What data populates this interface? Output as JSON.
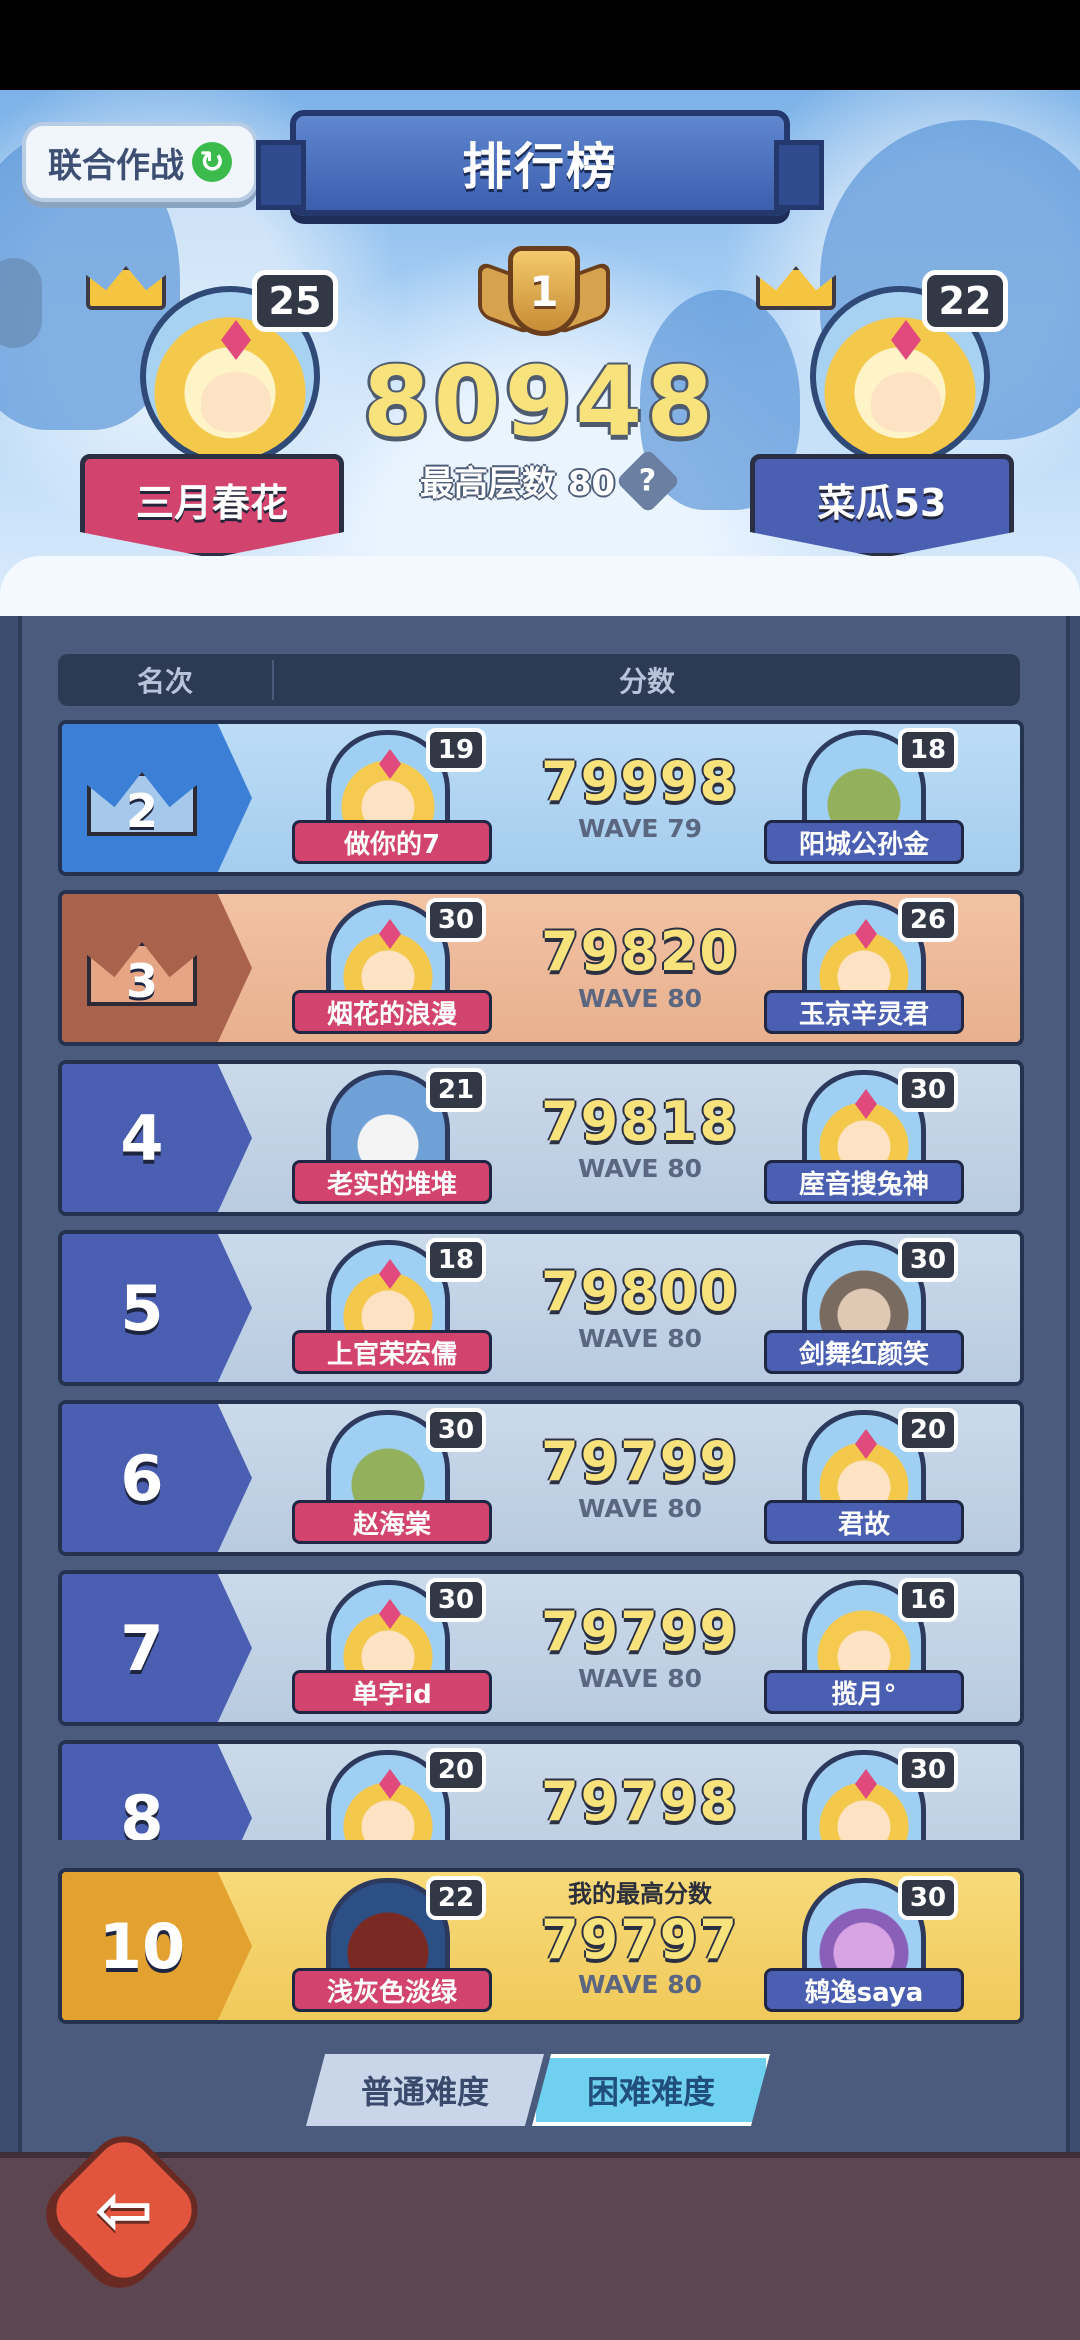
{
  "header": {
    "coop_label": "联合作战",
    "coop_icon": "refresh-icon",
    "title": "排行榜",
    "top_rank": "1",
    "top_score": "80948",
    "top_floor": "最高层数 80",
    "help_glyph": "?"
  },
  "champions": [
    {
      "name": "三月春花",
      "level": "25",
      "plate_color": "#d2436e"
    },
    {
      "name": "菜瓜53",
      "level": "22",
      "plate_color": "#4a5fb1"
    }
  ],
  "table": {
    "col_rank": "名次",
    "col_score": "分数",
    "rows": [
      {
        "rank": "2",
        "score": "79998",
        "wave": "WAVE 79",
        "p1": {
          "name": "做你的7",
          "level": "19"
        },
        "p2": {
          "name": "阳城公孙金",
          "level": "18"
        }
      },
      {
        "rank": "3",
        "score": "79820",
        "wave": "WAVE 80",
        "p1": {
          "name": "烟花的浪漫",
          "level": "30"
        },
        "p2": {
          "name": "玉京辛灵君",
          "level": "26"
        }
      },
      {
        "rank": "4",
        "score": "79818",
        "wave": "WAVE 80",
        "p1": {
          "name": "老实的堆堆",
          "level": "21"
        },
        "p2": {
          "name": "庢音搜兔神",
          "level": "30"
        }
      },
      {
        "rank": "5",
        "score": "79800",
        "wave": "WAVE 80",
        "p1": {
          "name": "上官荣宏儒",
          "level": "18"
        },
        "p2": {
          "name": "剑舞红颜笑",
          "level": "30"
        }
      },
      {
        "rank": "6",
        "score": "79799",
        "wave": "WAVE 80",
        "p1": {
          "name": "赵海棠",
          "level": "30"
        },
        "p2": {
          "name": "君故",
          "level": "20"
        }
      },
      {
        "rank": "7",
        "score": "79799",
        "wave": "WAVE 80",
        "p1": {
          "name": "单字id",
          "level": "30"
        },
        "p2": {
          "name": "揽月°",
          "level": "16"
        }
      },
      {
        "rank": "8",
        "score": "79798",
        "wave": "",
        "p1": {
          "name": "",
          "level": "20"
        },
        "p2": {
          "name": "",
          "level": "30"
        }
      }
    ]
  },
  "mine": {
    "label": "我的最高分数",
    "rank": "10",
    "score": "79797",
    "wave": "WAVE 80",
    "p1": {
      "name": "浅灰色淡绿",
      "level": "22"
    },
    "p2": {
      "name": "鸫逸saya",
      "level": "30"
    }
  },
  "difficulty": {
    "normal": "普通难度",
    "hard": "困难难度",
    "selected": "hard"
  },
  "footer": {
    "back_icon": "back-arrow-icon",
    "back_glyph": "⇦"
  }
}
